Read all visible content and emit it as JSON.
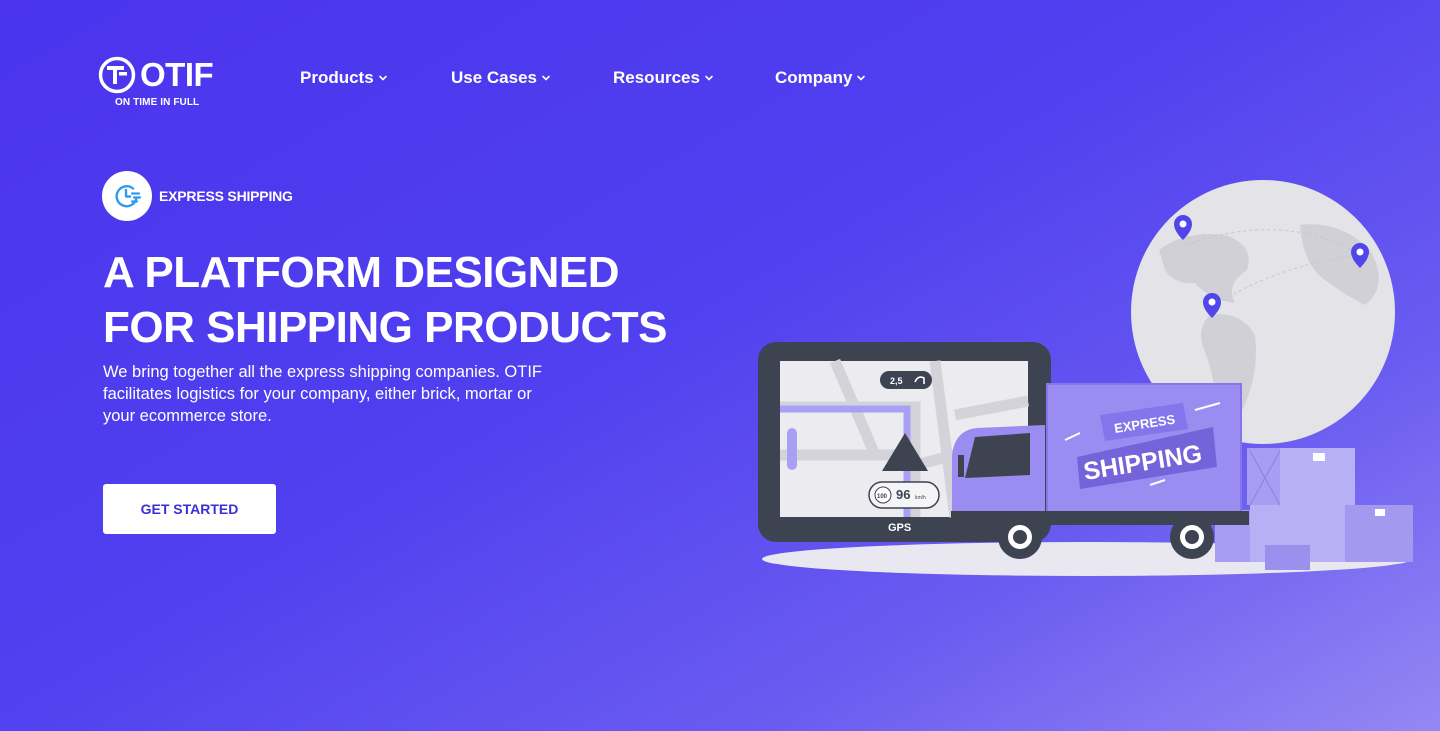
{
  "brand": {
    "name": "OTIF",
    "tagline": "ON TIME IN FULL"
  },
  "nav": {
    "items": [
      {
        "label": "Products"
      },
      {
        "label": "Use Cases"
      },
      {
        "label": "Resources"
      },
      {
        "label": "Company"
      }
    ]
  },
  "hero": {
    "badge_label": "EXPRESS SHIPPING",
    "headline_line1": "A PLATFORM DESIGNED",
    "headline_line2": "FOR SHIPPING PRODUCTS",
    "description": "We bring together all the express shipping companies. OTIF facilitates logistics for your company, either brick, mortar or your ecommerce store.",
    "cta_label": "GET STARTED"
  },
  "illustration": {
    "gps_label": "GPS",
    "distance": "2,5",
    "speed_limit": "100",
    "speed": "96",
    "speed_unit": "km/h",
    "truck_text_top": "EXPRESS",
    "truck_text_main": "SHIPPING"
  },
  "colors": {
    "background_start": "#4a34ee",
    "background_end": "#9587f3",
    "accent": "#3b2fd9",
    "truck": "#9b8cf2",
    "badge_icon": "#2f9bf0"
  }
}
